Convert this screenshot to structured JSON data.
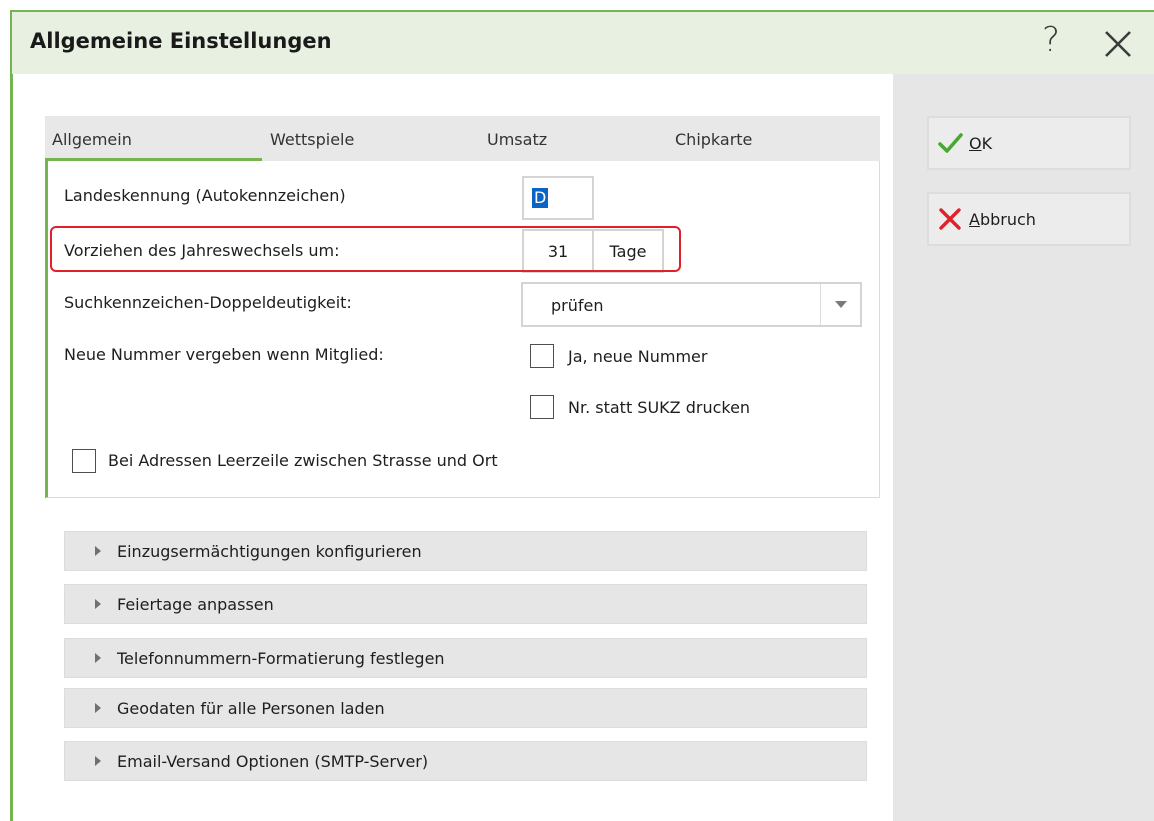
{
  "window": {
    "title": "Allgemeine Einstellungen",
    "help_glyph": "?",
    "accent_color": "#74b451"
  },
  "buttons": {
    "ok": {
      "mnemonic": "O",
      "rest": "K",
      "icon": "checkmark-icon"
    },
    "cancel": {
      "mnemonic": "A",
      "rest": "bbruch",
      "icon": "cross-icon"
    }
  },
  "tabs": [
    {
      "label": "Allgemein",
      "active": true
    },
    {
      "label": "Wettspiele",
      "active": false
    },
    {
      "label": "Umsatz",
      "active": false
    },
    {
      "label": "Chipkarte",
      "active": false
    }
  ],
  "general": {
    "country_code_label": "Landeskennung (Autokennzeichen)",
    "country_code_value": "D",
    "year_change_label": "Vorziehen des Jahreswechsels um:",
    "year_change_value": "31",
    "year_change_unit": "Tage",
    "search_label": "Suchkennzeichen-Doppeldeutigkeit:",
    "search_value": "prüfen",
    "new_number_label": "Neue Nummer vergeben wenn Mitglied:",
    "checkbox_new_number": "Ja, neue Nummer",
    "checkbox_print_nr": "Nr. statt SUKZ drucken",
    "checkbox_blank_line": "Bei Adressen Leerzeile zwischen Strasse und Ort",
    "highlight_color": "#e0212a"
  },
  "sections": [
    "Einzugsermächtigungen konfigurieren",
    "Feiertage anpassen",
    "Telefonnummern-Formatierung festlegen",
    "Geodaten für alle Personen laden",
    "Email-Versand Optionen (SMTP-Server)"
  ]
}
